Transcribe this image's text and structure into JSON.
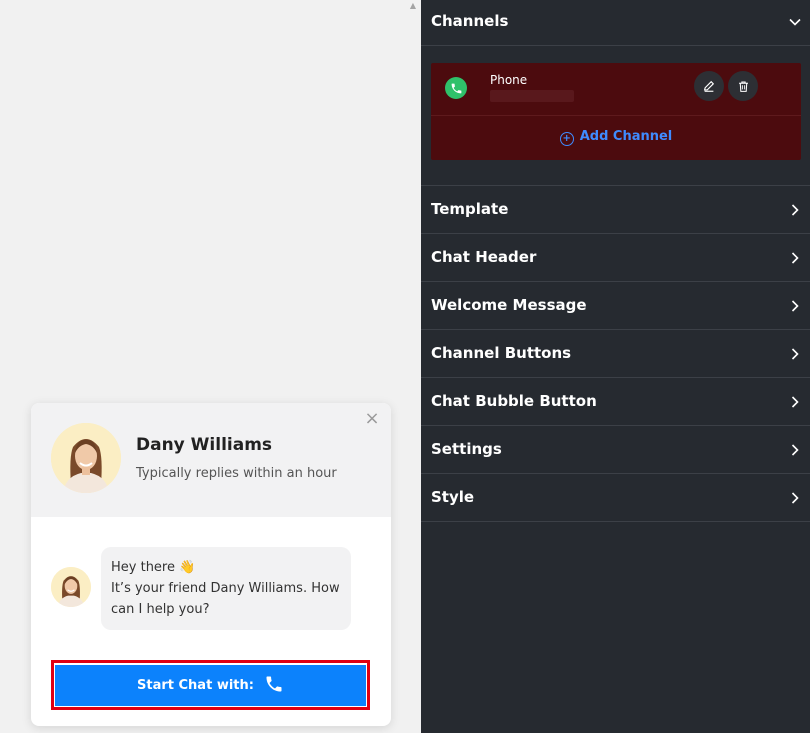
{
  "widget": {
    "agent_name": "Dany Williams",
    "agent_status": "Typically replies within an hour",
    "close_glyph": "×",
    "message_lines": [
      "Hey there 👋",
      "It’s your friend Dany Williams. How",
      "can I help you?"
    ],
    "start_chat_label": "Start Chat with:",
    "start_chat_icon": "phone-icon",
    "colors": {
      "button": "#0c82fc",
      "outline": "#e00012",
      "header_bg": "#f2f2f3"
    }
  },
  "panel": {
    "channels": {
      "title": "Channels",
      "items": [
        {
          "name": "Phone",
          "icon": "phone-icon",
          "color": "#2fc16a"
        }
      ],
      "add_label": "Add Channel"
    },
    "sections": [
      {
        "label": "Template"
      },
      {
        "label": "Chat Header"
      },
      {
        "label": "Welcome Message"
      },
      {
        "label": "Channel Buttons"
      },
      {
        "label": "Chat Bubble Button"
      },
      {
        "label": "Settings"
      },
      {
        "label": "Style"
      }
    ],
    "colors": {
      "bg": "#262a30",
      "channel_card": "#4c0b0e",
      "accent": "#3f8bff"
    }
  }
}
